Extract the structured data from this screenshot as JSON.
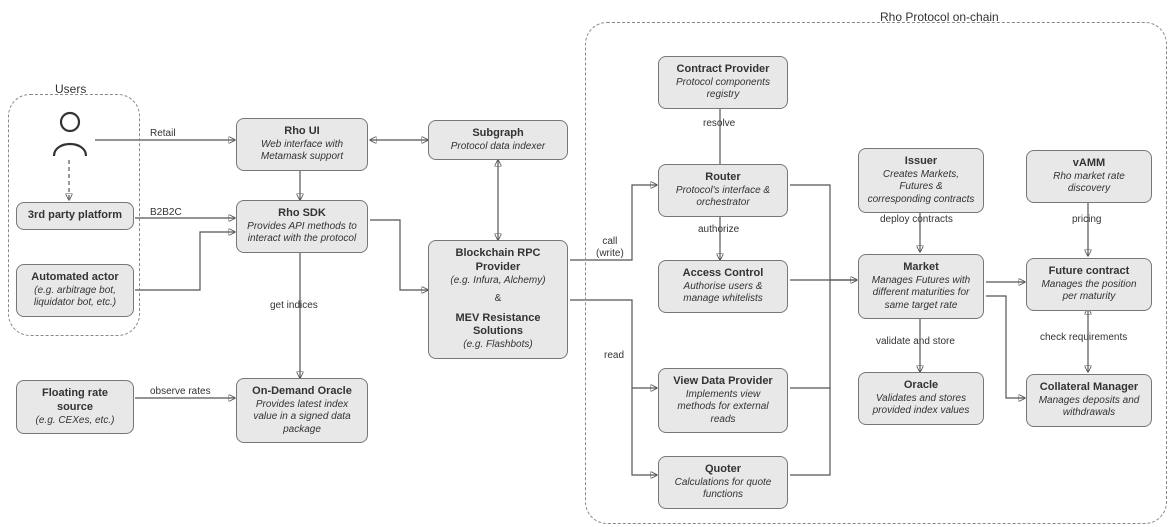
{
  "groups": {
    "users": "Users",
    "onchain": "Rho Protocol on-chain"
  },
  "nodes": {
    "third_party": {
      "title": "3rd party platform",
      "sub": ""
    },
    "automated_actor": {
      "title": "Automated actor",
      "sub": "(e.g. arbitrage bot, liquidator bot, etc.)"
    },
    "floating_rate": {
      "title": "Floating rate source",
      "sub": "(e.g. CEXes, etc.)"
    },
    "rho_ui": {
      "title": "Rho UI",
      "sub": "Web interface with Metamask support"
    },
    "rho_sdk": {
      "title": "Rho SDK",
      "sub": "Provides API methods to interact with the protocol"
    },
    "oracle_offchain": {
      "title": "On-Demand Oracle",
      "sub": "Provides latest index value in a signed data package"
    },
    "subgraph": {
      "title": "Subgraph",
      "sub": "Protocol data indexer"
    },
    "rpc": {
      "title": "Blockchain RPC Provider",
      "sub": "(e.g. Infura, Alchemy)",
      "extra": "&",
      "extra2": "MEV Resistance Solutions",
      "extra3": "(e.g. Flashbots)"
    },
    "contract_provider": {
      "title": "Contract Provider",
      "sub": "Protocol components registry"
    },
    "router": {
      "title": "Router",
      "sub": "Protocol's interface & orchestrator"
    },
    "access_control": {
      "title": "Access Control",
      "sub": "Authorise users & manage whitelists"
    },
    "view_data": {
      "title": "View Data Provider",
      "sub": "Implements view methods for external reads"
    },
    "quoter": {
      "title": "Quoter",
      "sub": "Calculations for quote functions"
    },
    "issuer": {
      "title": "Issuer",
      "sub": "Creates Markets, Futures & corresponding contracts"
    },
    "market": {
      "title": "Market",
      "sub": "Manages Futures with different maturities for same target rate"
    },
    "oracle_onchain": {
      "title": "Oracle",
      "sub": "Validates and stores provided index values"
    },
    "vamm": {
      "title": "vAMM",
      "sub": "Rho market rate discovery"
    },
    "future": {
      "title": "Future contract",
      "sub": "Manages the position per maturity"
    },
    "collateral": {
      "title": "Collateral Manager",
      "sub": "Manages deposits and withdrawals"
    }
  },
  "edges": {
    "retail": "Retail",
    "b2b2c": "B2B2C",
    "get_indices": "get indices",
    "observe_rates": "observe rates",
    "call_write": "call\n(write)",
    "read": "read",
    "resolve": "resolve",
    "authorize": "authorize",
    "deploy_contracts": "deploy contracts",
    "validate_store": "validate and store",
    "pricing": "pricing",
    "check_req": "check requirements"
  }
}
